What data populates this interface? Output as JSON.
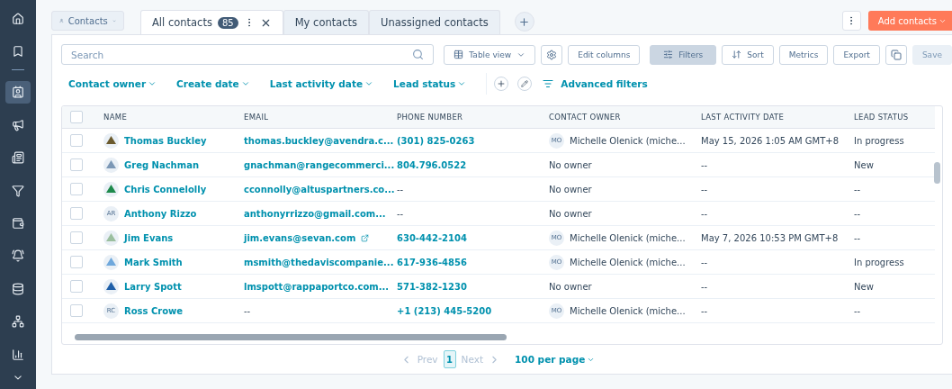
{
  "sidebar": {
    "items": [
      {
        "selected": false
      },
      {
        "selected": false
      },
      {
        "selected": true
      },
      {
        "selected": false
      },
      {
        "selected": false
      },
      {
        "selected": false
      },
      {
        "selected": false
      },
      {
        "selected": false
      },
      {
        "selected": false
      },
      {
        "selected": false
      },
      {
        "selected": false
      }
    ]
  },
  "object_switcher": {
    "label": "Contacts"
  },
  "tabs": [
    {
      "label": "All contacts",
      "count": "85",
      "selected": true
    },
    {
      "label": "My contacts",
      "selected": false
    },
    {
      "label": "Unassigned contacts",
      "selected": false
    }
  ],
  "add_button": {
    "label": "Add contacts"
  },
  "search": {
    "placeholder": "Search"
  },
  "toolbar": [
    {
      "label": "Table view",
      "kind": "dropdown",
      "active": false
    },
    {
      "kind": "settings",
      "active": false
    },
    {
      "label": "Edit columns",
      "kind": "button",
      "active": false
    },
    {
      "label": "Filters",
      "kind": "filters",
      "active": true
    },
    {
      "label": "Sort",
      "kind": "sort",
      "active": false
    },
    {
      "label": "Metrics",
      "kind": "button",
      "active": false
    },
    {
      "label": "Export",
      "kind": "button",
      "active": false
    },
    {
      "kind": "copy",
      "active": false
    },
    {
      "label": "Save",
      "kind": "save",
      "disabled": true
    }
  ],
  "filters": [
    "Contact owner",
    "Create date",
    "Last activity date",
    "Lead status"
  ],
  "advanced_filters": "Advanced filters",
  "table": {
    "select_all": {
      "checked": false
    },
    "columns": [
      "NAME",
      "EMAIL",
      "PHONE NUMBER",
      "CONTACT OWNER",
      "LAST ACTIVITY DATE",
      "LEAD STATUS"
    ],
    "rows": [
      {
        "checked": false,
        "avatar": {
          "kind": "logo"
        },
        "name": "Thomas Buckley",
        "email": "thomas.buckley@avendra.c...",
        "external": false,
        "phone": "(301) 825-0263",
        "owner": {
          "initials": "MO",
          "name": "Michelle Olenick (miche..."
        },
        "last_activity": "May 15, 2026 1:05 AM GMT+8",
        "lead_status": "In progress"
      },
      {
        "checked": false,
        "avatar": {
          "kind": "logo"
        },
        "name": "Greg Nachman",
        "email": "gnachman@rangecommerci...",
        "external": false,
        "phone": "804.796.0522",
        "owner": {
          "name": "No owner"
        },
        "last_activity": "--",
        "lead_status": "New"
      },
      {
        "checked": false,
        "avatar": {
          "kind": "logo"
        },
        "name": "Chris Connelolly",
        "email": "cconnolly@altuspartners.co...",
        "external": false,
        "phone": "--",
        "owner": {
          "name": "No owner"
        },
        "last_activity": "--",
        "lead_status": "--"
      },
      {
        "checked": false,
        "avatar": {
          "kind": "initials",
          "text": "AR"
        },
        "name": "Anthony Rizzo",
        "email": "anthonyrrizzo@gmail.com...",
        "external": false,
        "phone": "--",
        "owner": {
          "name": "No owner"
        },
        "last_activity": "--",
        "lead_status": "--"
      },
      {
        "checked": false,
        "avatar": {
          "kind": "logo"
        },
        "name": "Jim Evans",
        "email": "jim.evans@sevan.com",
        "external": true,
        "phone": "630-442-2104",
        "owner": {
          "initials": "MO",
          "name": "Michelle Olenick (miche..."
        },
        "last_activity": "May 7, 2026 10:53 PM GMT+8",
        "lead_status": "--"
      },
      {
        "checked": false,
        "avatar": {
          "kind": "logo"
        },
        "name": "Mark Smith",
        "email": "msmith@thedaviscompanie...",
        "external": false,
        "phone": "617-936-4856",
        "owner": {
          "initials": "MO",
          "name": "Michelle Olenick (miche..."
        },
        "last_activity": "--",
        "lead_status": "In progress"
      },
      {
        "checked": false,
        "avatar": {
          "kind": "logo"
        },
        "name": "Larry Spott",
        "email": "lmspott@rappaportco.com...",
        "external": false,
        "phone": "571-382-1230",
        "owner": {
          "name": "No owner"
        },
        "last_activity": "--",
        "lead_status": "New"
      },
      {
        "checked": false,
        "avatar": {
          "kind": "initials",
          "text": "RC"
        },
        "name": "Ross Crowe",
        "email": "--",
        "external": false,
        "phone": "+1 (213) 445-5200",
        "owner": {
          "initials": "MO",
          "name": "Michelle Olenick (miche..."
        },
        "last_activity": "--",
        "lead_status": "--"
      }
    ]
  },
  "pagination": {
    "prev": "Prev",
    "pages": [
      {
        "label": "1",
        "selected": true
      }
    ],
    "next": "Next",
    "per_page": "100 per page"
  }
}
